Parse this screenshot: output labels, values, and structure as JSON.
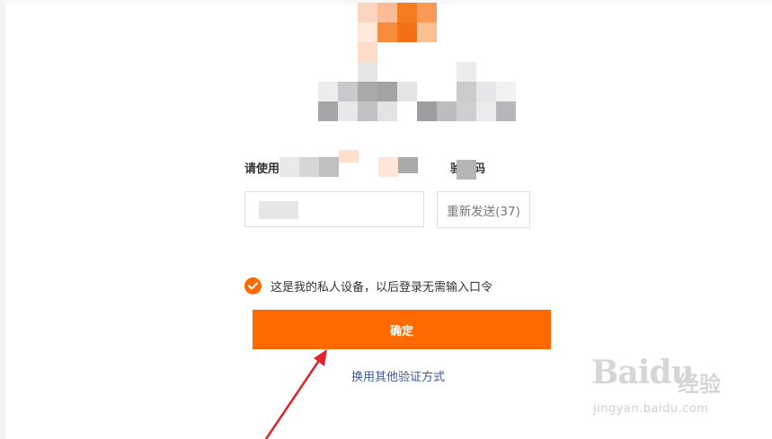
{
  "prompt": {
    "text_before": "请使用",
    "text_after": "验证码"
  },
  "code_input": {
    "placeholder": ""
  },
  "resend_button": {
    "label": "重新发送(37)"
  },
  "trusted_device": {
    "checked": true,
    "label": "这是我的私人设备，以后登录无需输入口令"
  },
  "confirm_button": {
    "label": "确定"
  },
  "alternate_link": {
    "label": "换用其他验证方式"
  },
  "watermark": {
    "brand": "Baidu",
    "brand_cn": "经验",
    "url": "jingyan.baidu.com"
  },
  "colors": {
    "accent": "#ff6a00",
    "link": "#3b5998",
    "annotation_arrow": "#e0242e"
  },
  "icons": {
    "check": "check-icon"
  }
}
